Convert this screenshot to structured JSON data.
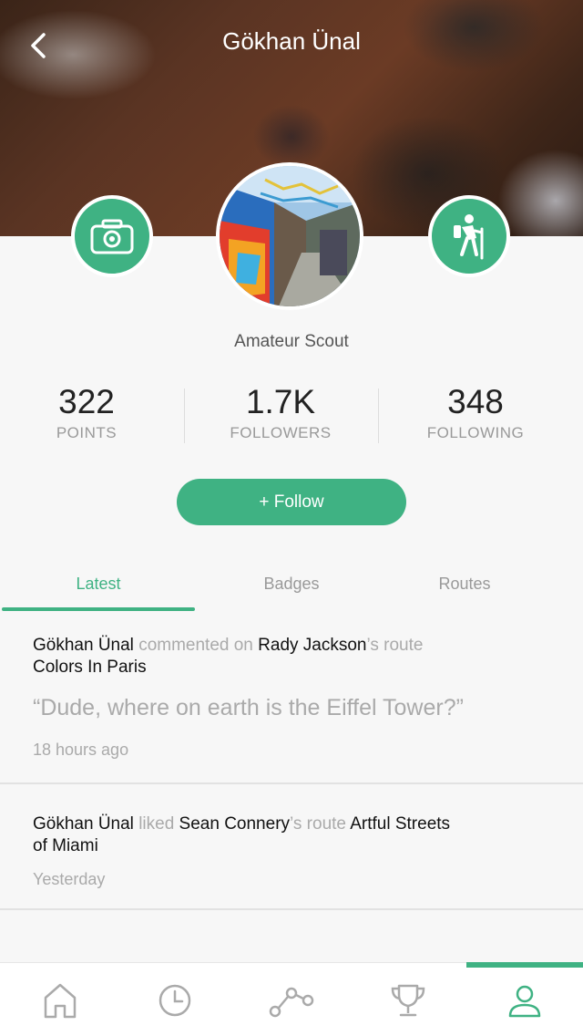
{
  "header": {
    "title": "Gökhan Ünal"
  },
  "profile": {
    "role": "Amateur Scout"
  },
  "stats": [
    {
      "value": "322",
      "label": "POINTS"
    },
    {
      "value": "1.7K",
      "label": "FOLLOWERS"
    },
    {
      "value": "348",
      "label": "FOLLOWING"
    }
  ],
  "follow_button": {
    "label": "+ Follow"
  },
  "tabs": [
    {
      "label": "Latest",
      "active": true
    },
    {
      "label": "Badges",
      "active": false
    },
    {
      "label": "Routes",
      "active": false
    }
  ],
  "feed": [
    {
      "actor": "Gökhan Ünal",
      "action": "commented on",
      "target_user": "Rady Jackson",
      "route_suffix": "’s route",
      "route_name": "Colors In Paris",
      "quote": "“Dude, where on earth is the Eiffel Tower?”",
      "time": "18 hours ago"
    },
    {
      "actor": "Gökhan Ünal",
      "action": "liked",
      "target_user": "Sean Connery",
      "route_suffix": "’s route",
      "route_name_part1": "Artful Streets",
      "route_name_part2": "of Miami",
      "time": "Yesterday"
    }
  ],
  "bottom_nav": [
    {
      "icon": "home-icon",
      "active": false
    },
    {
      "icon": "clock-icon",
      "active": false
    },
    {
      "icon": "route-icon",
      "active": false
    },
    {
      "icon": "trophy-icon",
      "active": false
    },
    {
      "icon": "profile-icon",
      "active": true
    }
  ],
  "colors": {
    "accent": "#3fb283",
    "muted": "#aaaaaa"
  }
}
